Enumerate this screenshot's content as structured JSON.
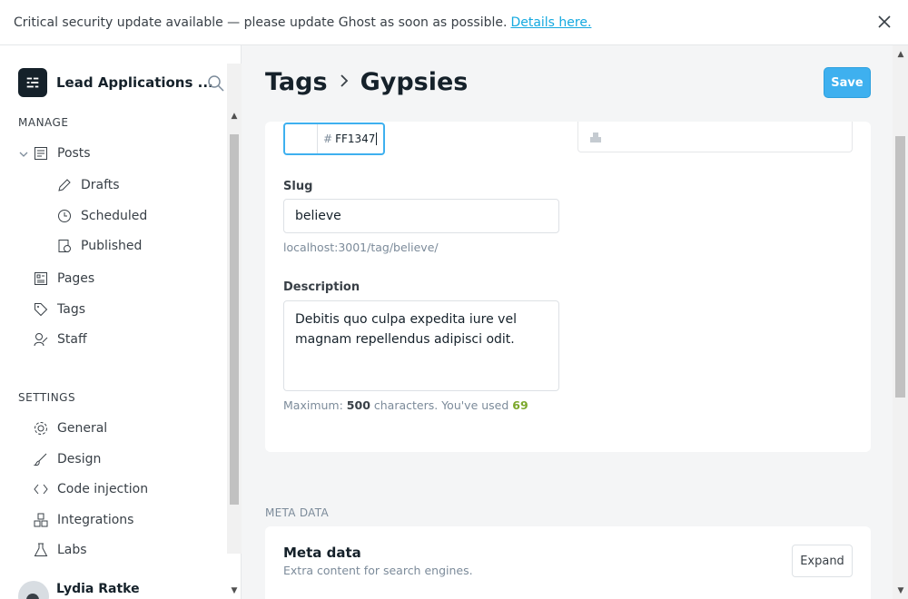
{
  "banner": {
    "message": "Critical security update available — please update Ghost as soon as possible.",
    "link": "Details here."
  },
  "sidebar": {
    "site_title": "Lead Applications ...",
    "manage_title": "MANAGE",
    "settings_title": "SETTINGS",
    "posts": "Posts",
    "drafts": "Drafts",
    "scheduled": "Scheduled",
    "published": "Published",
    "pages": "Pages",
    "tags": "Tags",
    "staff": "Staff",
    "general": "General",
    "design": "Design",
    "code_injection": "Code injection",
    "integrations": "Integrations",
    "labs": "Labs",
    "user_name": "Lydia Ratke"
  },
  "header": {
    "crumb_parent": "Tags",
    "crumb_current": "Gypsies",
    "save": "Save"
  },
  "form": {
    "color_hash": "#",
    "color_value": "FF1347",
    "slug_label": "Slug",
    "slug_value": "believe",
    "slug_url": "localhost:3001/tag/believe/",
    "description_label": "Description",
    "description_value": "Debitis quo culpa expedita iure vel magnam repellendus adipisci odit.",
    "max_label": "Maximum:",
    "max_value": "500",
    "max_mid": "characters. You've used",
    "used_value": "69"
  },
  "meta": {
    "section_title": "META DATA",
    "card_title": "Meta data",
    "card_sub": "Extra content for search engines.",
    "expand": "Expand"
  },
  "colors": {
    "accent": "#3eb0ef",
    "success_count": "#7ca82c",
    "link": "#14a9e0"
  }
}
